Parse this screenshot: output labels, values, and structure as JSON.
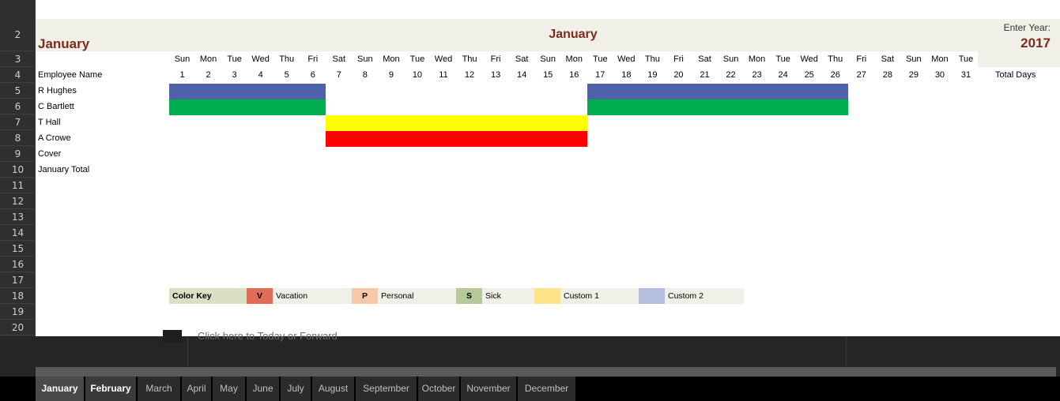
{
  "sheet": {
    "row_numbers": [
      "2",
      "3",
      "4",
      "5",
      "6",
      "7",
      "8",
      "9",
      "10",
      "11",
      "12",
      "13",
      "14",
      "15",
      "16",
      "17",
      "18",
      "19",
      "20"
    ],
    "title_left": "January",
    "title_center": "January",
    "year_label": "Enter Year:",
    "year_value": "2017",
    "col_header_label": "Employee Name",
    "total_days_label": "Total Days",
    "weekdays": [
      "Sun",
      "Mon",
      "Tue",
      "Wed",
      "Thu",
      "Fri",
      "Sat",
      "Sun",
      "Mon",
      "Tue",
      "Wed",
      "Thu",
      "Fri",
      "Sat",
      "Sun",
      "Mon",
      "Tue",
      "Wed",
      "Thu",
      "Fri",
      "Sat",
      "Sun",
      "Mon",
      "Tue",
      "Wed",
      "Thu",
      "Fri",
      "Sat",
      "Sun",
      "Mon",
      "Tue"
    ],
    "days": [
      "1",
      "2",
      "3",
      "4",
      "5",
      "6",
      "7",
      "8",
      "9",
      "10",
      "11",
      "12",
      "13",
      "14",
      "15",
      "16",
      "17",
      "18",
      "19",
      "20",
      "21",
      "22",
      "23",
      "24",
      "25",
      "26",
      "27",
      "28",
      "29",
      "30",
      "31"
    ],
    "employees": [
      "R Hughes",
      "C Bartlett",
      "T Hall",
      "A Crowe",
      "Cover",
      "January Total"
    ],
    "absences": [
      {
        "employee": "R Hughes",
        "from_day": 1,
        "to_day": 6,
        "color": "#4f61a9"
      },
      {
        "employee": "R Hughes",
        "from_day": 17,
        "to_day": 26,
        "color": "#4f61a9"
      },
      {
        "employee": "C Bartlett",
        "from_day": 1,
        "to_day": 6,
        "color": "#00b050"
      },
      {
        "employee": "C Bartlett",
        "from_day": 17,
        "to_day": 26,
        "color": "#00b050"
      },
      {
        "employee": "T Hall",
        "from_day": 7,
        "to_day": 16,
        "color": "#ffff00"
      },
      {
        "employee": "A Crowe",
        "from_day": 7,
        "to_day": 16,
        "color": "#ff0000"
      }
    ]
  },
  "color_key": {
    "title": "Color Key",
    "items": [
      {
        "code": "V",
        "label": "Vacation",
        "swatch": "#e06c5a"
      },
      {
        "code": "P",
        "label": "Personal",
        "swatch": "#f5c9a8"
      },
      {
        "code": "S",
        "label": "Sick",
        "swatch": "#b5c99a"
      },
      {
        "code": "",
        "label": "Custom 1",
        "swatch": "#fde38a"
      },
      {
        "code": "",
        "label": "Custom 2",
        "swatch": "#b4bfe0"
      }
    ]
  },
  "overlay": {
    "text": "Click here to Today or Forward"
  },
  "tabs": [
    "January",
    "February",
    "March",
    "April",
    "May",
    "June",
    "July",
    "August",
    "September",
    "October",
    "November",
    "December"
  ],
  "active_tab": "January"
}
